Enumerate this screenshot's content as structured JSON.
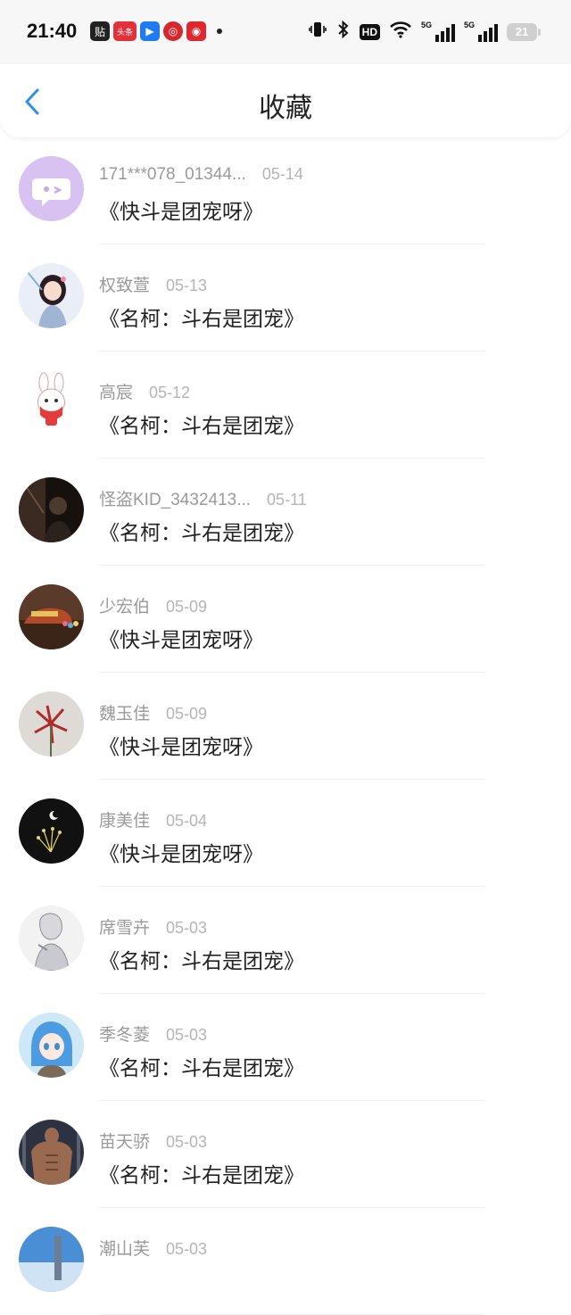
{
  "status_bar": {
    "time": "21:40",
    "apps": [
      {
        "icon": "tieba-app-icon",
        "glyph": "贴",
        "style": "dark"
      },
      {
        "icon": "toutiao-app-icon",
        "glyph": "头条",
        "style": "red"
      },
      {
        "icon": "bluebird-app-icon",
        "glyph": "▶",
        "style": "blue"
      },
      {
        "icon": "pinduoduo-app-icon",
        "glyph": "◎",
        "style": "red2"
      },
      {
        "icon": "netease-app-icon",
        "glyph": "◉",
        "style": "red3"
      }
    ],
    "hd_label": "HD",
    "signal_label_1": "5G",
    "signal_label_2": "5G",
    "battery": "21"
  },
  "header": {
    "title": "收藏",
    "back_icon": "chevron-left-icon",
    "accent_color": "#2f8ff0"
  },
  "items": [
    {
      "name": "171***078_01344...",
      "date": "05-14",
      "book": "《快斗是团宠呀》",
      "avatar": "chat-bubble",
      "avatar_colors": [
        "#d7c2f2",
        "#c8a9ee"
      ]
    },
    {
      "name": "权致萱",
      "date": "05-13",
      "book": "《名柯：斗右是团宠》",
      "avatar": "anime-girl",
      "avatar_colors": [
        "#e9eef7",
        "#9fb5d3"
      ]
    },
    {
      "name": "高宸",
      "date": "05-12",
      "book": "《名柯：斗右是团宠》",
      "avatar": "bunny",
      "avatar_colors": [
        "#ffffff",
        "#e53b3b"
      ]
    },
    {
      "name": "怪盗KID_3432413...",
      "date": "05-11",
      "book": "《名柯：斗右是团宠》",
      "avatar": "dark-photo",
      "avatar_colors": [
        "#3a2a22",
        "#17110e"
      ]
    },
    {
      "name": "少宏伯",
      "date": "05-09",
      "book": "《快斗是团宠呀》",
      "avatar": "hat-photo",
      "avatar_colors": [
        "#b34a2a",
        "#e5c35a"
      ]
    },
    {
      "name": "魏玉佳",
      "date": "05-09",
      "book": "《快斗是团宠呀》",
      "avatar": "red-flower",
      "avatar_colors": [
        "#dedbd6",
        "#b42a2a"
      ]
    },
    {
      "name": "康美佳",
      "date": "05-04",
      "book": "《快斗是团宠呀》",
      "avatar": "night-moon",
      "avatar_colors": [
        "#111111",
        "#e8d36a"
      ]
    },
    {
      "name": "席雪卉",
      "date": "05-03",
      "book": "《名柯：斗右是团宠》",
      "avatar": "sketch-boy",
      "avatar_colors": [
        "#f2f2f2",
        "#8c8c96"
      ]
    },
    {
      "name": "季冬菱",
      "date": "05-03",
      "book": "《名柯：斗右是团宠》",
      "avatar": "blue-anime",
      "avatar_colors": [
        "#cfe8f7",
        "#4d9be0"
      ]
    },
    {
      "name": "苗天骄",
      "date": "05-03",
      "book": "《名柯：斗右是团宠》",
      "avatar": "muscle-photo",
      "avatar_colors": [
        "#2c3240",
        "#9a6a50"
      ]
    },
    {
      "name": "潮山芙",
      "date": "05-03",
      "book": "",
      "avatar": "sky-photo",
      "avatar_colors": [
        "#4a8fd6",
        "#cfe3f5"
      ]
    }
  ]
}
